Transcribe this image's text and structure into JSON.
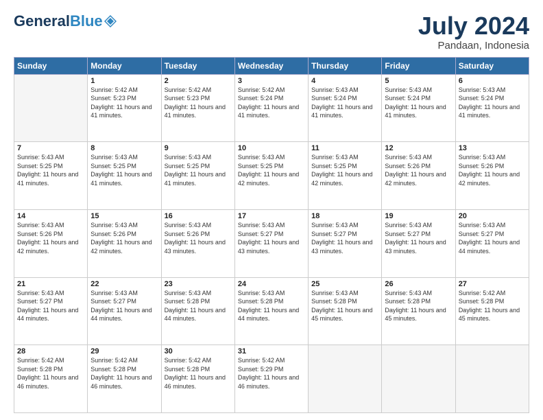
{
  "header": {
    "logo_general": "General",
    "logo_blue": "Blue",
    "month_title": "July 2024",
    "location": "Pandaan, Indonesia"
  },
  "days_of_week": [
    "Sunday",
    "Monday",
    "Tuesday",
    "Wednesday",
    "Thursday",
    "Friday",
    "Saturday"
  ],
  "weeks": [
    [
      {
        "day": "",
        "sunrise": "",
        "sunset": "",
        "daylight": "",
        "empty": true
      },
      {
        "day": "1",
        "sunrise": "Sunrise: 5:42 AM",
        "sunset": "Sunset: 5:23 PM",
        "daylight": "Daylight: 11 hours and 41 minutes."
      },
      {
        "day": "2",
        "sunrise": "Sunrise: 5:42 AM",
        "sunset": "Sunset: 5:23 PM",
        "daylight": "Daylight: 11 hours and 41 minutes."
      },
      {
        "day": "3",
        "sunrise": "Sunrise: 5:42 AM",
        "sunset": "Sunset: 5:24 PM",
        "daylight": "Daylight: 11 hours and 41 minutes."
      },
      {
        "day": "4",
        "sunrise": "Sunrise: 5:43 AM",
        "sunset": "Sunset: 5:24 PM",
        "daylight": "Daylight: 11 hours and 41 minutes."
      },
      {
        "day": "5",
        "sunrise": "Sunrise: 5:43 AM",
        "sunset": "Sunset: 5:24 PM",
        "daylight": "Daylight: 11 hours and 41 minutes."
      },
      {
        "day": "6",
        "sunrise": "Sunrise: 5:43 AM",
        "sunset": "Sunset: 5:24 PM",
        "daylight": "Daylight: 11 hours and 41 minutes."
      }
    ],
    [
      {
        "day": "7",
        "sunrise": "Sunrise: 5:43 AM",
        "sunset": "Sunset: 5:25 PM",
        "daylight": "Daylight: 11 hours and 41 minutes."
      },
      {
        "day": "8",
        "sunrise": "Sunrise: 5:43 AM",
        "sunset": "Sunset: 5:25 PM",
        "daylight": "Daylight: 11 hours and 41 minutes."
      },
      {
        "day": "9",
        "sunrise": "Sunrise: 5:43 AM",
        "sunset": "Sunset: 5:25 PM",
        "daylight": "Daylight: 11 hours and 41 minutes."
      },
      {
        "day": "10",
        "sunrise": "Sunrise: 5:43 AM",
        "sunset": "Sunset: 5:25 PM",
        "daylight": "Daylight: 11 hours and 42 minutes."
      },
      {
        "day": "11",
        "sunrise": "Sunrise: 5:43 AM",
        "sunset": "Sunset: 5:25 PM",
        "daylight": "Daylight: 11 hours and 42 minutes."
      },
      {
        "day": "12",
        "sunrise": "Sunrise: 5:43 AM",
        "sunset": "Sunset: 5:26 PM",
        "daylight": "Daylight: 11 hours and 42 minutes."
      },
      {
        "day": "13",
        "sunrise": "Sunrise: 5:43 AM",
        "sunset": "Sunset: 5:26 PM",
        "daylight": "Daylight: 11 hours and 42 minutes."
      }
    ],
    [
      {
        "day": "14",
        "sunrise": "Sunrise: 5:43 AM",
        "sunset": "Sunset: 5:26 PM",
        "daylight": "Daylight: 11 hours and 42 minutes."
      },
      {
        "day": "15",
        "sunrise": "Sunrise: 5:43 AM",
        "sunset": "Sunset: 5:26 PM",
        "daylight": "Daylight: 11 hours and 42 minutes."
      },
      {
        "day": "16",
        "sunrise": "Sunrise: 5:43 AM",
        "sunset": "Sunset: 5:26 PM",
        "daylight": "Daylight: 11 hours and 43 minutes."
      },
      {
        "day": "17",
        "sunrise": "Sunrise: 5:43 AM",
        "sunset": "Sunset: 5:27 PM",
        "daylight": "Daylight: 11 hours and 43 minutes."
      },
      {
        "day": "18",
        "sunrise": "Sunrise: 5:43 AM",
        "sunset": "Sunset: 5:27 PM",
        "daylight": "Daylight: 11 hours and 43 minutes."
      },
      {
        "day": "19",
        "sunrise": "Sunrise: 5:43 AM",
        "sunset": "Sunset: 5:27 PM",
        "daylight": "Daylight: 11 hours and 43 minutes."
      },
      {
        "day": "20",
        "sunrise": "Sunrise: 5:43 AM",
        "sunset": "Sunset: 5:27 PM",
        "daylight": "Daylight: 11 hours and 44 minutes."
      }
    ],
    [
      {
        "day": "21",
        "sunrise": "Sunrise: 5:43 AM",
        "sunset": "Sunset: 5:27 PM",
        "daylight": "Daylight: 11 hours and 44 minutes."
      },
      {
        "day": "22",
        "sunrise": "Sunrise: 5:43 AM",
        "sunset": "Sunset: 5:27 PM",
        "daylight": "Daylight: 11 hours and 44 minutes."
      },
      {
        "day": "23",
        "sunrise": "Sunrise: 5:43 AM",
        "sunset": "Sunset: 5:28 PM",
        "daylight": "Daylight: 11 hours and 44 minutes."
      },
      {
        "day": "24",
        "sunrise": "Sunrise: 5:43 AM",
        "sunset": "Sunset: 5:28 PM",
        "daylight": "Daylight: 11 hours and 44 minutes."
      },
      {
        "day": "25",
        "sunrise": "Sunrise: 5:43 AM",
        "sunset": "Sunset: 5:28 PM",
        "daylight": "Daylight: 11 hours and 45 minutes."
      },
      {
        "day": "26",
        "sunrise": "Sunrise: 5:43 AM",
        "sunset": "Sunset: 5:28 PM",
        "daylight": "Daylight: 11 hours and 45 minutes."
      },
      {
        "day": "27",
        "sunrise": "Sunrise: 5:42 AM",
        "sunset": "Sunset: 5:28 PM",
        "daylight": "Daylight: 11 hours and 45 minutes."
      }
    ],
    [
      {
        "day": "28",
        "sunrise": "Sunrise: 5:42 AM",
        "sunset": "Sunset: 5:28 PM",
        "daylight": "Daylight: 11 hours and 46 minutes."
      },
      {
        "day": "29",
        "sunrise": "Sunrise: 5:42 AM",
        "sunset": "Sunset: 5:28 PM",
        "daylight": "Daylight: 11 hours and 46 minutes."
      },
      {
        "day": "30",
        "sunrise": "Sunrise: 5:42 AM",
        "sunset": "Sunset: 5:28 PM",
        "daylight": "Daylight: 11 hours and 46 minutes."
      },
      {
        "day": "31",
        "sunrise": "Sunrise: 5:42 AM",
        "sunset": "Sunset: 5:29 PM",
        "daylight": "Daylight: 11 hours and 46 minutes."
      },
      {
        "day": "",
        "sunrise": "",
        "sunset": "",
        "daylight": "",
        "empty": true
      },
      {
        "day": "",
        "sunrise": "",
        "sunset": "",
        "daylight": "",
        "empty": true
      },
      {
        "day": "",
        "sunrise": "",
        "sunset": "",
        "daylight": "",
        "empty": true
      }
    ]
  ]
}
